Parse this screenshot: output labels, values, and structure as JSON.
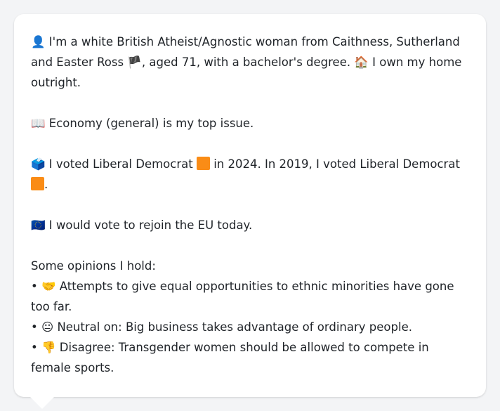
{
  "profile": {
    "line1_icon": "👤",
    "line1_text_a": "I'm a white British Atheist/Agnostic woman from Caithness, Sutherland and Easter Ross",
    "flag_icon": "🏴",
    "line1_text_b": ", aged 71, with a bachelor's degree.",
    "home_icon": "🏠",
    "line1_text_c": "I own my home outright."
  },
  "issue": {
    "icon": "📖",
    "text": "Economy (general) is my top issue."
  },
  "vote": {
    "icon": "🗳️",
    "text_a": "I voted Liberal Democrat",
    "text_b": "in 2024. In 2019, I voted Liberal Democrat",
    "text_c": ".",
    "party_color": "#fa8c16"
  },
  "eu": {
    "icon": "🇪🇺",
    "text": "I would vote to rejoin the EU today."
  },
  "opinions": {
    "heading": "Some opinions I hold:",
    "bullet": "•",
    "items": [
      {
        "icon": "🤝",
        "text": "Attempts to give equal opportunities to ethnic minorities have gone too far."
      },
      {
        "icon": "😐",
        "text": "Neutral on: Big business takes advantage of ordinary people."
      },
      {
        "icon": "👎",
        "text": "Disagree: Transgender women should be allowed to compete in female sports."
      }
    ]
  }
}
